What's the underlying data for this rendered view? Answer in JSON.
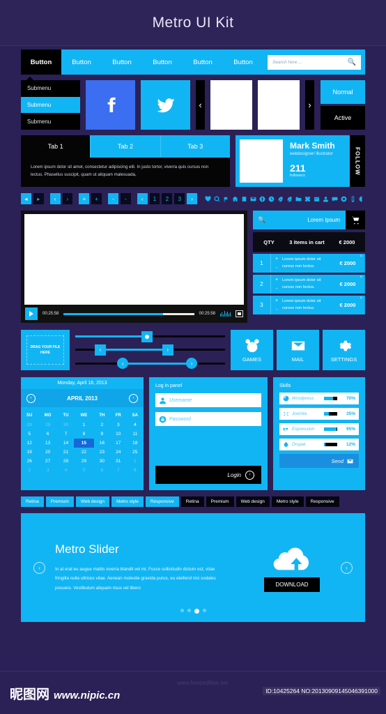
{
  "header": {
    "title": "Metro UI Kit"
  },
  "buttonbar": {
    "buttons": [
      "Button",
      "Button",
      "Button",
      "Button",
      "Button",
      "Button"
    ],
    "search_placeholder": "Search here ...",
    "search_icon": "search-icon"
  },
  "submenu": {
    "items": [
      "Submenu",
      "Submenu",
      "Submenu"
    ],
    "active_index": 1
  },
  "social": [
    {
      "name": "facebook",
      "icon": "facebook-icon",
      "color": "#3b6ef0"
    },
    {
      "name": "twitter",
      "icon": "twitter-icon",
      "color": "#12b5f3"
    }
  ],
  "gallery": {
    "prev": "‹",
    "next": "›"
  },
  "states": {
    "normal": "Normal",
    "active": "Active"
  },
  "tabs": {
    "items": [
      "Tab 1",
      "Tab 2",
      "Tab 3"
    ],
    "active_index": 0,
    "body": "Lorem ipsum dolor sit amet, consectetur adipiscing elit. In justo tortor, viverra quis cursus non lectus. Phasellus suscipit, quam ut aliquam malesuada,"
  },
  "profile": {
    "name": "Mark Smith",
    "role": "webdesigner/ illustrator",
    "count": "211",
    "count_label": "followers",
    "follow_label": "FOLLOW"
  },
  "pagination": {
    "buttons": [
      "◂",
      "▸",
      "‹",
      "›",
      "+",
      "+",
      "-",
      "-",
      "‹",
      "1",
      "2",
      "3",
      "›"
    ],
    "icons": [
      "heart-icon",
      "search-icon",
      "flag-icon",
      "home-icon",
      "book-icon",
      "mail-icon",
      "globe-icon",
      "clock-icon",
      "leaf-icon",
      "leaf-icon",
      "folder-icon",
      "puzzle-icon",
      "calendar-icon",
      "user-icon",
      "comment-icon",
      "target-icon",
      "mobile-icon",
      "contrast-icon"
    ]
  },
  "video": {
    "play_icon": "play-icon",
    "time_current": "00:25:58",
    "time_total": "00:25:58",
    "progress_percent": 76,
    "volume_icon": "equalizer-icon",
    "fullscreen_icon": "fullscreen-icon"
  },
  "cart": {
    "search_icon": "search-icon",
    "select_value": "Lorem Ipsum",
    "cart_icon": "cart-icon",
    "header": {
      "qty": "QTY",
      "items": "3 items in cart",
      "total": "€ 2000"
    },
    "rows": [
      {
        "num": "1",
        "desc": "Lorem ipsum dolor sit cursus non lectus.",
        "price": "€ 2000"
      },
      {
        "num": "2",
        "desc": "Lorem ipsum dolor sit cursus non lectus.",
        "price": "€ 2000"
      },
      {
        "num": "3",
        "desc": "Lorem ipsum dolor sit cursus non lectus.",
        "price": "€ 2000"
      }
    ]
  },
  "upload": {
    "label": "DRAG YOUR FILE HERE"
  },
  "sliders_widget": [
    {
      "type": "single",
      "value_percent": 48
    },
    {
      "type": "range",
      "start_percent": 15,
      "end_percent": 62
    },
    {
      "type": "range-round",
      "start_percent": 30,
      "end_percent": 78
    }
  ],
  "tiles": [
    {
      "label": "GAMES",
      "icon": "game-face-icon"
    },
    {
      "label": "MAIL",
      "icon": "envelope-icon"
    },
    {
      "label": "SETTINGS",
      "icon": "gear-icon"
    }
  ],
  "calendar": {
    "top_date": "Monday, April 18, 2013",
    "month": "APRIL 2013",
    "prev_icon": "chevron-left-icon",
    "next_icon": "chevron-right-icon",
    "weekdays": [
      "SU",
      "MO",
      "TU",
      "WE",
      "TH",
      "FR",
      "SA"
    ],
    "weeks": [
      [
        {
          "d": "28",
          "mute": true
        },
        {
          "d": "29",
          "mute": true
        },
        {
          "d": "30",
          "mute": true
        },
        {
          "d": "1"
        },
        {
          "d": "2"
        },
        {
          "d": "3"
        },
        {
          "d": "4"
        }
      ],
      [
        {
          "d": "5"
        },
        {
          "d": "6"
        },
        {
          "d": "7"
        },
        {
          "d": "8"
        },
        {
          "d": "9"
        },
        {
          "d": "10"
        },
        {
          "d": "11"
        }
      ],
      [
        {
          "d": "12"
        },
        {
          "d": "13"
        },
        {
          "d": "14"
        },
        {
          "d": "15",
          "sel": true
        },
        {
          "d": "16"
        },
        {
          "d": "17"
        },
        {
          "d": "18"
        }
      ],
      [
        {
          "d": "19"
        },
        {
          "d": "20"
        },
        {
          "d": "21"
        },
        {
          "d": "22"
        },
        {
          "d": "23"
        },
        {
          "d": "24"
        },
        {
          "d": "25"
        }
      ],
      [
        {
          "d": "26"
        },
        {
          "d": "27"
        },
        {
          "d": "28"
        },
        {
          "d": "29"
        },
        {
          "d": "30"
        },
        {
          "d": "31"
        },
        {
          "d": "1",
          "mute": true
        }
      ],
      [
        {
          "d": "2",
          "mute": true
        },
        {
          "d": "3",
          "mute": true
        },
        {
          "d": "4",
          "mute": true
        },
        {
          "d": "5",
          "mute": true
        },
        {
          "d": "6",
          "mute": true
        },
        {
          "d": "7",
          "mute": true
        },
        {
          "d": "8",
          "mute": true
        }
      ]
    ]
  },
  "login": {
    "title": "Log in panel",
    "username_placeholder": "Username",
    "password_placeholder": "Password",
    "username_icon": "user-icon",
    "password_icon": "lock-icon",
    "button_label": "Login",
    "button_icon": "chevron-right-icon"
  },
  "skills": {
    "title": "Skills",
    "rows": [
      {
        "name": "Wordpress",
        "percent_label": "70%",
        "percent": 70,
        "icon": "wordpress-icon"
      },
      {
        "name": "Joomla",
        "percent_label": "35%",
        "percent": 35,
        "icon": "joomla-icon"
      },
      {
        "name": "Expression",
        "percent_label": "95%",
        "percent": 95,
        "icon": "expression-icon"
      },
      {
        "name": "Drupal",
        "percent_label": "12%",
        "percent": 12,
        "icon": "drupal-icon"
      }
    ],
    "send_label": "Send",
    "send_icon": "envelope-icon"
  },
  "tags": [
    {
      "label": "Retina",
      "style": "light"
    },
    {
      "label": "Premium",
      "style": "light"
    },
    {
      "label": "Web design",
      "style": "light"
    },
    {
      "label": "Metro style",
      "style": "light"
    },
    {
      "label": "Responsive",
      "style": "light"
    },
    {
      "label": "Retina",
      "style": "dark"
    },
    {
      "label": "Premium",
      "style": "dark"
    },
    {
      "label": "Web design",
      "style": "dark"
    },
    {
      "label": "Metro style",
      "style": "dark"
    },
    {
      "label": "Responsive",
      "style": "dark"
    }
  ],
  "slider": {
    "title": "Metro Slider",
    "text": "In at erat eu augue mattis viverra blandit vel mi. Fusce sollicitudin dictum est, vitae fringilla nulla ultrices vitae. Aenean molestie gravida purus, eu eleifend nisi sodales posuere. Vestibulum aliquam risus vel libero",
    "prev_icon": "chevron-left-icon",
    "next_icon": "chevron-right-icon",
    "cloud_icon": "cloud-download-icon",
    "download_label": "DOWNLOAD",
    "dots": 4,
    "active_dot": 2
  },
  "footer": {
    "brand_cn": "昵图网",
    "brand_url": "www.nipic.cn",
    "watermark": "www.freepsdfiles.net",
    "id_text": "ID:10425264 NO:20130909145046391000"
  },
  "colors": {
    "accent": "#12b5f3",
    "bg": "#2b2156",
    "dark": "#000000",
    "facebook": "#3b6ef0"
  }
}
